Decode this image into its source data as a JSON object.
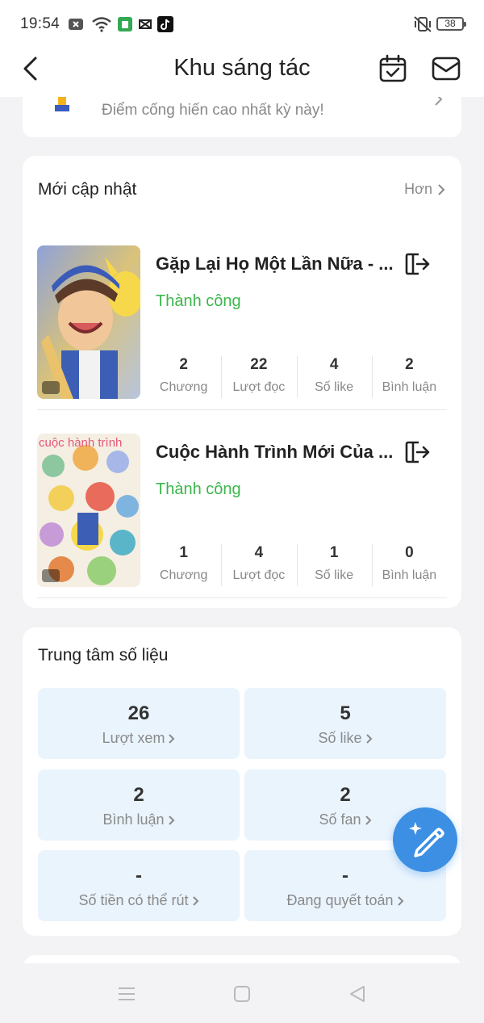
{
  "status_bar": {
    "time": "19:54",
    "battery": "38",
    "icons": [
      "close-box-icon",
      "wifi-icon",
      "app-green-icon",
      "capcut-icon",
      "tiktok-icon",
      "vibrate-silent-icon"
    ]
  },
  "header": {
    "title": "Khu sáng tác",
    "back_icon": "back-arrow-icon",
    "calendar_icon": "calendar-check-icon",
    "mail_icon": "mail-icon"
  },
  "top_card": {
    "text": "Điểm cống hiến cao nhất kỳ này!"
  },
  "updates": {
    "title": "Mới cập nhật",
    "more_label": "Hơn",
    "stat_labels": [
      "Chương",
      "Lượt đọc",
      "Số like",
      "Bình luận"
    ],
    "stories": [
      {
        "title": "Gặp Lại Họ Một Lần Nữa - ...",
        "status": "Thành công",
        "stats": [
          "2",
          "22",
          "4",
          "2"
        ]
      },
      {
        "title": "Cuộc Hành Trình Mới Của ...",
        "status": "Thành công",
        "cover_text": "cuộc hành trình",
        "stats": [
          "1",
          "4",
          "1",
          "0"
        ]
      }
    ]
  },
  "data_center": {
    "title": "Trung tâm số liệu",
    "tiles": [
      {
        "value": "26",
        "label": "Lượt xem"
      },
      {
        "value": "5",
        "label": "Số like"
      },
      {
        "value": "2",
        "label": "Bình luận"
      },
      {
        "value": "2",
        "label": "Số fan"
      },
      {
        "value": "-",
        "label": "Số tiền có thể rút"
      },
      {
        "value": "-",
        "label": "Đang quyết toán"
      }
    ]
  },
  "colors": {
    "accent": "#3d8fe4",
    "success": "#3cb64b",
    "tile_bg": "#eaf4fd",
    "page_bg": "#f3f3f5"
  },
  "fab": {
    "icon": "pen-sparkle-icon"
  },
  "nav_bar": {
    "icons": [
      "menu-icon",
      "home-square-icon",
      "back-triangle-icon"
    ]
  }
}
